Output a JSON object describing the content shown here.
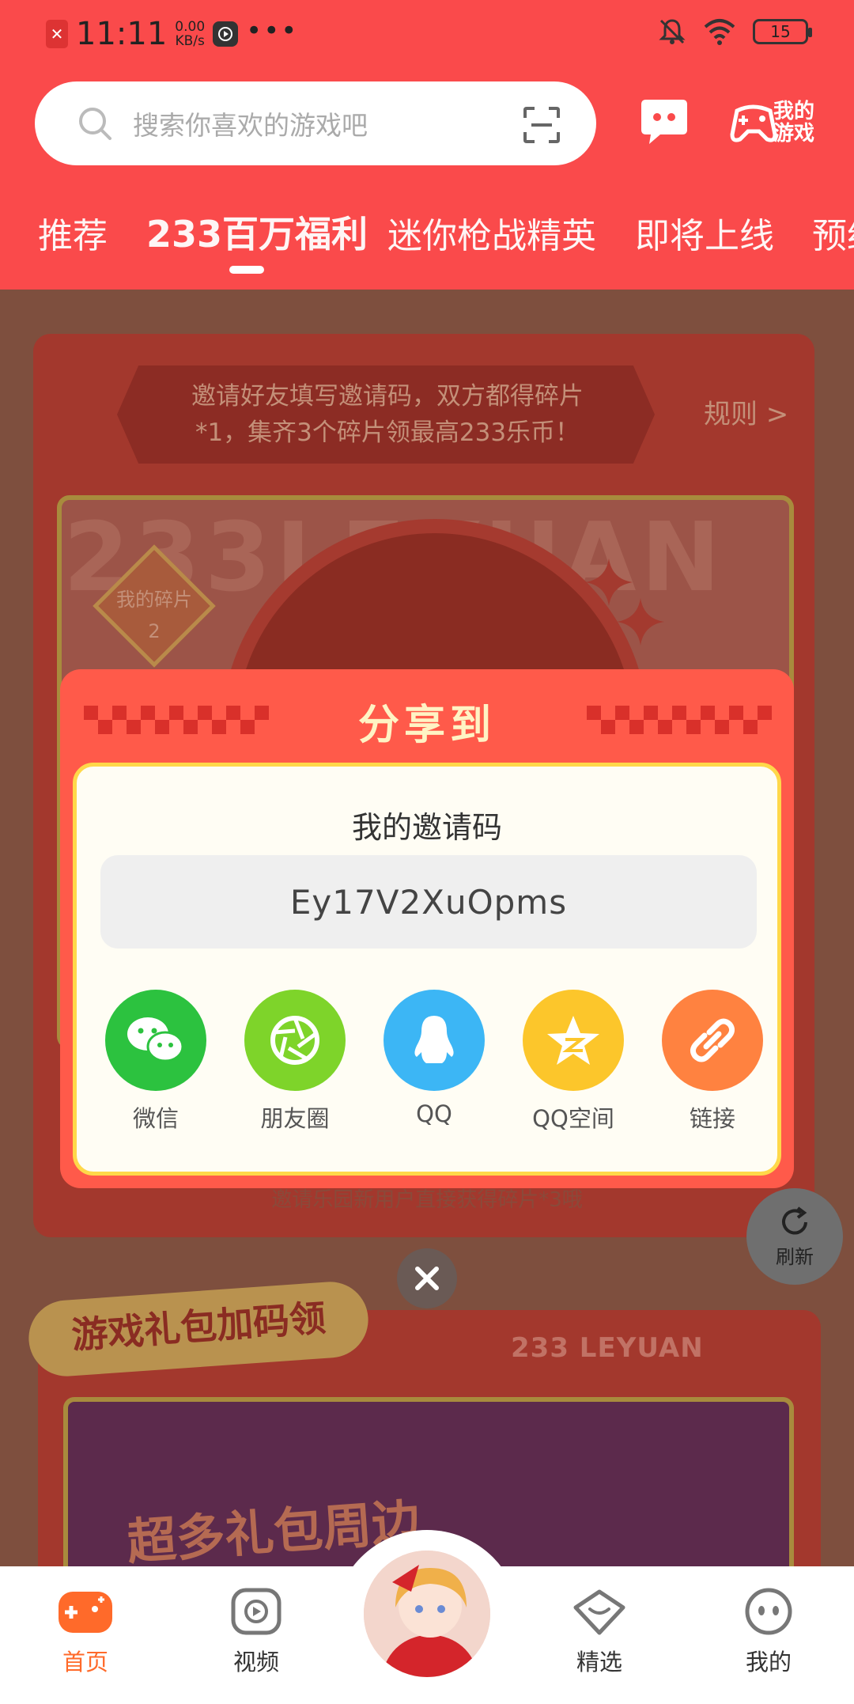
{
  "status_bar": {
    "time": "11:11",
    "speed_value": "0.00",
    "speed_unit": "KB/s",
    "battery": "15"
  },
  "search": {
    "placeholder": "搜索你喜欢的游戏吧"
  },
  "header": {
    "my_games_label": "我的\n游戏"
  },
  "tabs": [
    {
      "label": "推荐",
      "active": false
    },
    {
      "label": "233百万福利",
      "active": true
    },
    {
      "label": "迷你枪战精英",
      "active": false
    },
    {
      "label": "即将上线",
      "active": false
    },
    {
      "label": "预约",
      "active": false
    }
  ],
  "invite_section": {
    "rule_text_line1": "邀请好友填写邀请码，双方都得碎片",
    "rule_text_line2": "*1，集齐3个碎片领最高233乐币！",
    "rule_link": "规则 >",
    "panel_bg_text": "233LEYUAN",
    "fragment_label": "我的碎片",
    "fragment_count": "2",
    "caption": "邀请乐园新用户直接获得碎片*3哦"
  },
  "gift_section": {
    "title": "游戏礼包加码领",
    "leyuan": "233 LEYUAN",
    "banner_text": "超多礼包周边"
  },
  "share_dialog": {
    "title": "分享到",
    "subtitle": "我的邀请码",
    "invite_code": "Ey17V2XuOpms",
    "options": [
      {
        "label": "微信",
        "icon": "wechat-icon",
        "color": "#2cc23f"
      },
      {
        "label": "朋友圈",
        "icon": "moments-icon",
        "color": "#7ed42a"
      },
      {
        "label": "QQ",
        "icon": "qq-icon",
        "color": "#3cb6f5"
      },
      {
        "label": "QQ空间",
        "icon": "qzone-icon",
        "color": "#fcc62b"
      },
      {
        "label": "链接",
        "icon": "link-icon",
        "color": "#ff8240"
      }
    ]
  },
  "refresh": {
    "label": "刷新"
  },
  "bottom_nav": [
    {
      "label": "首页",
      "icon": "gamepad-icon",
      "active": true
    },
    {
      "label": "视频",
      "icon": "video-icon",
      "active": false
    },
    {
      "label": "精选",
      "icon": "featured-icon",
      "active": false
    },
    {
      "label": "我的",
      "icon": "profile-icon",
      "active": false
    }
  ],
  "colors": {
    "header_red": "#fa4a4b",
    "dialog_red": "#ff5a4a",
    "accent_orange": "#ff6a2a",
    "dialog_border_yellow": "#ffd84a"
  }
}
